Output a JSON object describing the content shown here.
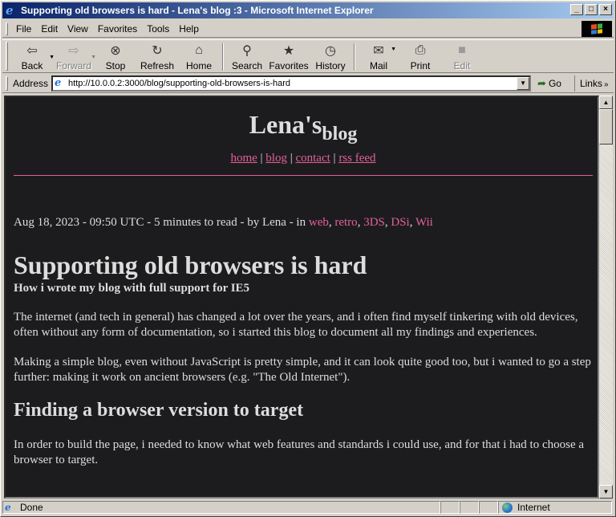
{
  "window": {
    "title": "Supporting old browsers is hard - Lena's blog :3 - Microsoft Internet Explorer",
    "controls": [
      "_",
      "□",
      "×"
    ]
  },
  "menu": {
    "items": [
      "File",
      "Edit",
      "View",
      "Favorites",
      "Tools",
      "Help"
    ]
  },
  "toolbar": {
    "buttons": [
      {
        "label": "Back",
        "icon": "back-arrow-icon",
        "enabled": true
      },
      {
        "label": "Forward",
        "icon": "forward-arrow-icon",
        "enabled": false
      },
      {
        "label": "Stop",
        "icon": "stop-icon",
        "enabled": true
      },
      {
        "label": "Refresh",
        "icon": "refresh-icon",
        "enabled": true
      },
      {
        "label": "Home",
        "icon": "home-icon",
        "enabled": true
      },
      {
        "label": "Search",
        "icon": "search-icon",
        "enabled": true
      },
      {
        "label": "Favorites",
        "icon": "favorites-icon",
        "enabled": true
      },
      {
        "label": "History",
        "icon": "history-icon",
        "enabled": true
      },
      {
        "label": "Mail",
        "icon": "mail-icon",
        "enabled": true
      },
      {
        "label": "Print",
        "icon": "print-icon",
        "enabled": true
      },
      {
        "label": "Edit",
        "icon": "edit-icon",
        "enabled": false
      }
    ]
  },
  "address": {
    "label": "Address",
    "url": "http://10.0.0.2:3000/blog/supporting-old-browsers-is-hard",
    "go_label": "Go",
    "links_label": "Links"
  },
  "page": {
    "site_title_main": "Lena's",
    "site_title_sub": "blog",
    "nav": [
      "home",
      "blog",
      "contact",
      "rss feed"
    ],
    "meta_prefix": "Aug 18, 2023 - 09:50 UTC - 5 minutes to read - by Lena - in ",
    "tags": [
      "web",
      "retro",
      "3DS",
      "DSi",
      "Wii"
    ],
    "post_title": "Supporting old browsers is hard",
    "post_subtitle": "How i wrote my blog with full support for IE5",
    "paragraph_1": "The internet (and tech in general) has changed a lot over the years, and i often find myself tinkering with old devices, often without any form of documentation, so i started this blog to document all my findings and experiences.",
    "paragraph_2": "Making a simple blog, even without JavaScript is pretty simple, and it can look quite good too, but i wanted to go a step further: making it work on ancient browsers (e.g. \"The Old Internet\").",
    "heading_2": "Finding a browser version to target",
    "paragraph_3": "In order to build the page, i needed to know what web features and standards i could use, and for that i had to choose a browser to target."
  },
  "status": {
    "text": "Done",
    "zone": "Internet"
  },
  "colors": {
    "title_bar": "#0a246a",
    "page_background": "#1c1c1e",
    "accent": "#e45f9b",
    "text": "#dddddd"
  }
}
